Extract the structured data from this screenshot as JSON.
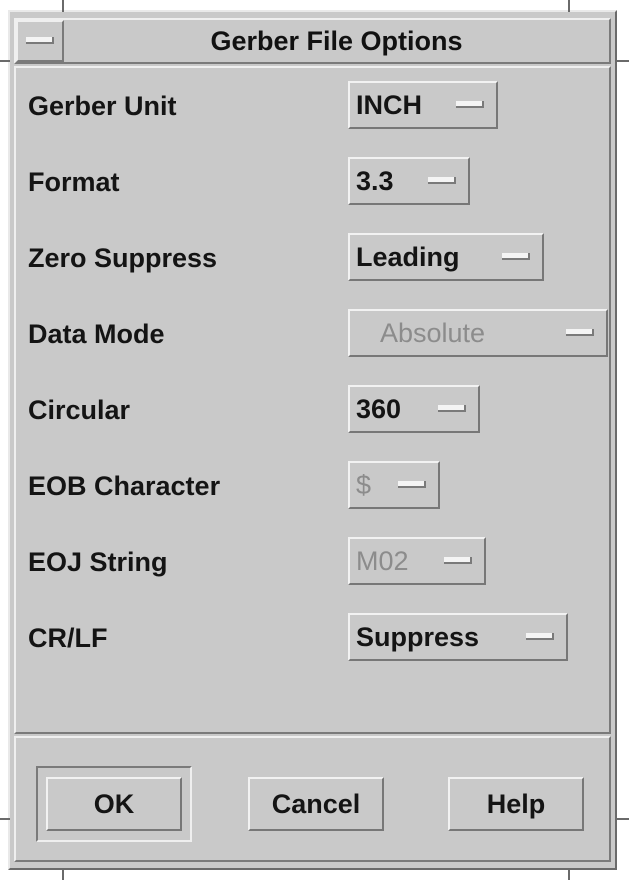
{
  "window": {
    "title": "Gerber File Options"
  },
  "fields": [
    {
      "label": "Gerber Unit",
      "value": "INCH",
      "enabled": true
    },
    {
      "label": "Format",
      "value": "3.3",
      "enabled": true
    },
    {
      "label": "Zero Suppress",
      "value": "Leading",
      "enabled": true
    },
    {
      "label": "Data Mode",
      "value": "Absolute",
      "enabled": false
    },
    {
      "label": "Circular",
      "value": "360",
      "enabled": true
    },
    {
      "label": "EOB Character",
      "value": "$",
      "enabled": false
    },
    {
      "label": "EOJ String",
      "value": "M02",
      "enabled": false
    },
    {
      "label": "CR/LF",
      "value": "Suppress",
      "enabled": true
    }
  ],
  "buttons": {
    "ok": "OK",
    "cancel": "Cancel",
    "help": "Help"
  },
  "colors": {
    "background": "#c9c9c9",
    "highlight": "#efefef",
    "shadow": "#7a7a7a",
    "text": "#141414",
    "disabled_text": "#8c8c8c"
  }
}
